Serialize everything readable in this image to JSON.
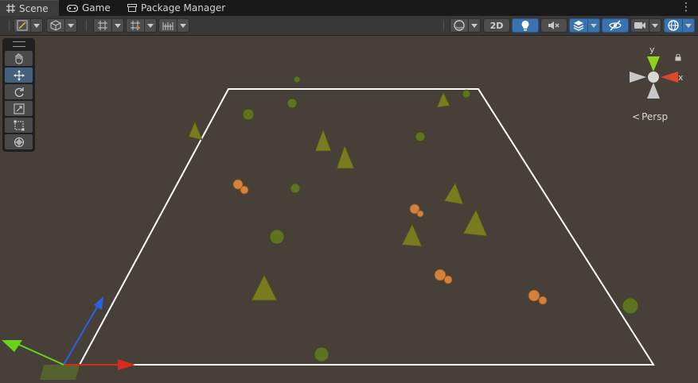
{
  "tabs": [
    {
      "label": "Scene",
      "icon": "scene-grid-icon",
      "active": true
    },
    {
      "label": "Game",
      "icon": "gamepad-icon",
      "active": false
    },
    {
      "label": "Package Manager",
      "icon": "package-icon",
      "active": false
    }
  ],
  "toolbar": {
    "left": [
      {
        "name": "draw-mode-button",
        "icon": "shaded-mode-icon"
      },
      {
        "name": "render-mode-button",
        "icon": "cube-icon"
      },
      {
        "name": "grid-snap-button",
        "icon": "grid-snap-icon"
      },
      {
        "name": "grid-visibility-button",
        "icon": "grid-visibility-icon"
      },
      {
        "name": "increment-snap-button",
        "icon": "ruler-icon"
      }
    ],
    "right": [
      {
        "name": "global-shading-button",
        "icon": "sphere-icon"
      },
      {
        "name": "2d-toggle-button",
        "label": "2D"
      },
      {
        "name": "lighting-toggle-button",
        "icon": "lightbulb-icon"
      },
      {
        "name": "audio-toggle-button",
        "icon": "speaker-muted-icon"
      },
      {
        "name": "effects-button",
        "icon": "layers-icon"
      },
      {
        "name": "hidden-objects-button",
        "icon": "eye-slash-icon"
      },
      {
        "name": "camera-button",
        "icon": "camera-icon"
      },
      {
        "name": "gizmos-button",
        "icon": "gizmo-sphere-icon"
      }
    ]
  },
  "tools": [
    {
      "name": "hand-tool",
      "icon": "hand-icon",
      "selected": false
    },
    {
      "name": "move-tool",
      "icon": "move-arrows-icon",
      "selected": true
    },
    {
      "name": "rotate-tool",
      "icon": "rotate-icon",
      "selected": false
    },
    {
      "name": "scale-tool",
      "icon": "scale-icon",
      "selected": false
    },
    {
      "name": "rect-tool",
      "icon": "rect-icon",
      "selected": false
    },
    {
      "name": "transform-tool",
      "icon": "transform-icon",
      "selected": false
    }
  ],
  "orientation_gizmo": {
    "y_label": "y",
    "x_label": "x",
    "projection_label": "Persp",
    "colors": {
      "y": "#8ed21c",
      "x": "#e0462a",
      "z_neg": "#c8c8c8"
    }
  },
  "scene": {
    "background_color": "#474038",
    "plane_border_color": "#ffffff",
    "axis_colors": {
      "x": "#d72a21",
      "y": "#67d21c",
      "z": "#2a62e6"
    },
    "objects": [
      {
        "type": "pine-tree",
        "color": "#7a7a1e"
      },
      {
        "type": "round-tree",
        "color": "#5d7322"
      },
      {
        "type": "orange-bush",
        "color": "#d2823c"
      }
    ]
  }
}
